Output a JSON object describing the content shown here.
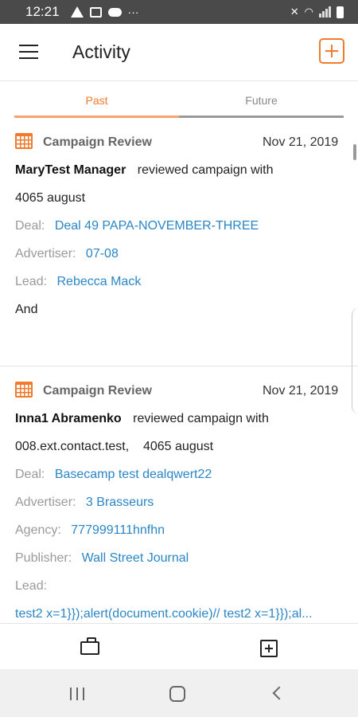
{
  "status_bar": {
    "time": "12:21",
    "more": "···"
  },
  "app_bar": {
    "title": "Activity"
  },
  "tabs": [
    {
      "label": "Past",
      "active": true
    },
    {
      "label": "Future",
      "active": false
    }
  ],
  "activities": [
    {
      "type": "Campaign Review",
      "date": "Nov 21, 2019",
      "actor": "MaryTest Manager",
      "action": "reviewed campaign with",
      "subject": "4065 august",
      "deal_label": "Deal:",
      "deal": "Deal 49 PAPA-NOVEMBER-THREE",
      "advertiser_label": "Advertiser:",
      "advertiser": "07-08",
      "lead_label": "Lead:",
      "lead": "Rebecca Mack",
      "note": "And"
    },
    {
      "type": "Campaign Review",
      "date": "Nov 21, 2019",
      "actor": "Inna1 Abramenko",
      "action": "reviewed campaign with",
      "subject": "008.ext.contact.test,    4065 august",
      "deal_label": "Deal:",
      "deal": "Basecamp test dealqwert22",
      "advertiser_label": "Advertiser:",
      "advertiser": "3 Brasseurs",
      "agency_label": "Agency:",
      "agency": "777999111hnfhn",
      "publisher_label": "Publisher:",
      "publisher": "Wall Street Journal",
      "lead_label": "Lead:",
      "lead": "test2 x=1}});alert(document.cookie)// test2 x=1}});al..."
    }
  ],
  "colors": {
    "accent": "#f07b2d",
    "link": "#2a86c6",
    "status_bar": "#4a4a4a"
  },
  "icons": {
    "menu": "menu-icon",
    "add": "add-icon",
    "calendar": "calendar-icon",
    "briefcase": "briefcase-icon"
  }
}
